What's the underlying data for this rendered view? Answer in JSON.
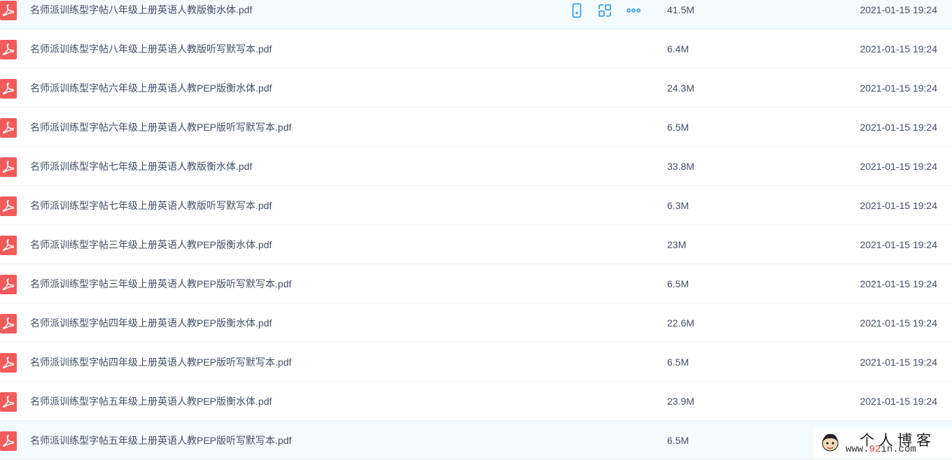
{
  "files": [
    {
      "name": "名师派训练型字帖八年级上册英语人教版衡水体.pdf",
      "size": "41.5M",
      "date": "2021-01-15 19:24",
      "icon": "pdf-file-icon"
    },
    {
      "name": "名师派训练型字帖八年级上册英语人教版听写默写本.pdf",
      "size": "6.4M",
      "date": "2021-01-15 19:24",
      "icon": "pdf-file-icon"
    },
    {
      "name": "名师派训练型字帖六年级上册英语人教PEP版衡水体.pdf",
      "size": "24.3M",
      "date": "2021-01-15 19:24",
      "icon": "pdf-file-icon"
    },
    {
      "name": "名师派训练型字帖六年级上册英语人教PEP版听写默写本.pdf",
      "size": "6.5M",
      "date": "2021-01-15 19:24",
      "icon": "pdf-file-icon"
    },
    {
      "name": "名师派训练型字帖七年级上册英语人教版衡水体.pdf",
      "size": "33.8M",
      "date": "2021-01-15 19:24",
      "icon": "pdf-file-icon"
    },
    {
      "name": "名师派训练型字帖七年级上册英语人教版听写默写本.pdf",
      "size": "6.3M",
      "date": "2021-01-15 19:24",
      "icon": "pdf-file-icon"
    },
    {
      "name": "名师派训练型字帖三年级上册英语人教PEP版衡水体.pdf",
      "size": "23M",
      "date": "2021-01-15 19:24",
      "icon": "pdf-file-icon"
    },
    {
      "name": "名师派训练型字帖三年级上册英语人教PEP版听写默写本.pdf",
      "size": "6.5M",
      "date": "2021-01-15 19:24",
      "icon": "pdf-file-icon"
    },
    {
      "name": "名师派训练型字帖四年级上册英语人教PEP版衡水体.pdf",
      "size": "22.6M",
      "date": "2021-01-15 19:24",
      "icon": "pdf-file-icon"
    },
    {
      "name": "名师派训练型字帖四年级上册英语人教PEP版听写默写本.pdf",
      "size": "6.5M",
      "date": "2021-01-15 19:24",
      "icon": "pdf-file-icon"
    },
    {
      "name": "名师派训练型字帖五年级上册英语人教PEP版衡水体.pdf",
      "size": "23.9M",
      "date": "2021-01-15 19:24",
      "icon": "pdf-file-icon"
    },
    {
      "name": "名师派训练型字帖五年级上册英语人教PEP版听写默写本.pdf",
      "size": "6.5M",
      "date": "",
      "icon": "pdf-file-icon"
    }
  ],
  "hover_actions": [
    "phone-icon",
    "share-icon",
    "more-icon"
  ],
  "colors": {
    "pdf": "#f15b5c",
    "action": "#3b9de6",
    "text": "#424e67",
    "hover_bg": "#f4fbff"
  },
  "watermark": {
    "title": "个人博客",
    "url_prefix": "www.",
    "url_digits": "92",
    "url_suffix": "in.com"
  }
}
